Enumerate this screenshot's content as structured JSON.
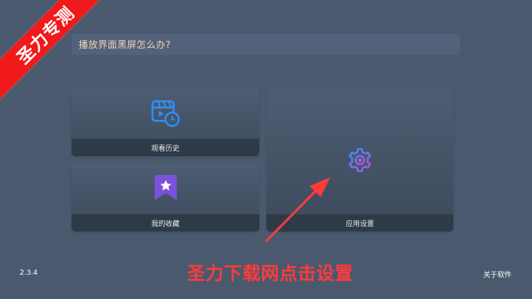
{
  "faq": {
    "text": "播放界面黑屏怎么办?"
  },
  "cards": {
    "history": {
      "label": "观看历史",
      "icon": "history-film-clock-icon"
    },
    "favorites": {
      "label": "我的收藏",
      "icon": "bookmark-star-icon"
    },
    "settings": {
      "label": "应用设置",
      "icon": "gear-icon"
    }
  },
  "footer": {
    "version": "2.3.4",
    "about_label": "关于软件"
  },
  "overlay": {
    "ribbon_text": "圣力专测",
    "caption": "圣力下载网点击设置"
  },
  "colors": {
    "background": "#4a596e",
    "accent_blue": "#2f8ff0",
    "accent_purple": "#7b52d9",
    "overlay_red": "#ff3b3b"
  }
}
